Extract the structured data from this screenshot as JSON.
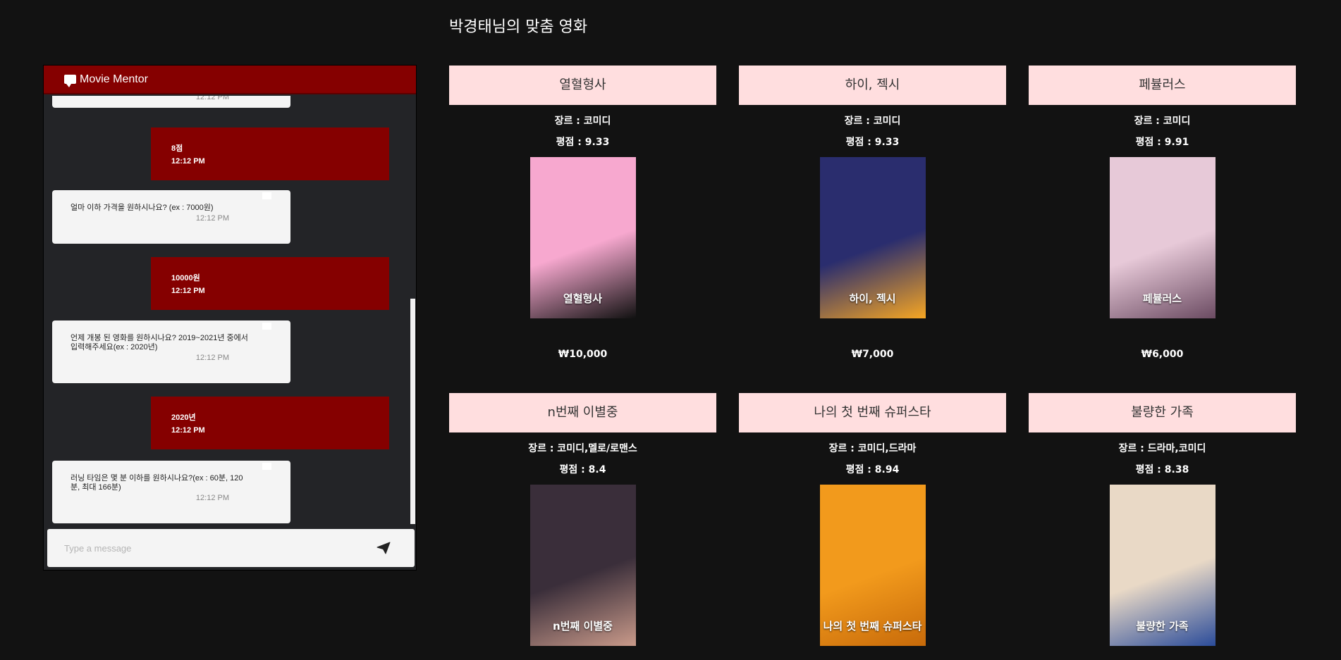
{
  "page": {
    "title": "박경태님의 맞춤 영화"
  },
  "chat": {
    "title": "Movie Mentor",
    "input_placeholder": "Type a message",
    "partial_top_time": "12:12 PM",
    "messages": [
      {
        "from": "user",
        "text": "8점",
        "time": "12:12 PM"
      },
      {
        "from": "bot",
        "text": "얼마 이하 가격을 원하시나요? (ex : 7000원)",
        "time": "12:12 PM"
      },
      {
        "from": "user",
        "text": "10000원",
        "time": "12:12 PM"
      },
      {
        "from": "bot",
        "text": "언제 개봉 된 영화를 원하시나요? 2019~2021년 중에서 입력해주세요(ex : 2020년)",
        "time": "12:12 PM"
      },
      {
        "from": "user",
        "text": "2020년",
        "time": "12:12 PM"
      },
      {
        "from": "bot",
        "text": "러닝 타임은 몇 분 이하를 원하시나요?(ex : 60분, 120분, 최대 166분)",
        "time": "12:12 PM"
      }
    ]
  },
  "movies": [
    {
      "title": "열혈형사",
      "genre": "장르 : 코미디",
      "rating": "평점 : 9.33",
      "price": "₩10,000",
      "poster_text": "열혈형사",
      "poster_colors": [
        "#f7a8cf",
        "#111111"
      ]
    },
    {
      "title": "하이, 젝시",
      "genre": "장르 : 코미디",
      "rating": "평점 : 9.33",
      "price": "₩7,000",
      "poster_text": "하이, 젝시",
      "poster_colors": [
        "#2a2d6e",
        "#f6a623"
      ]
    },
    {
      "title": "페뷸러스",
      "genre": "장르 : 코미디",
      "rating": "평점 : 9.91",
      "price": "₩6,000",
      "poster_text": "페뷸러스",
      "poster_colors": [
        "#e7c9d8",
        "#6b4b62"
      ]
    },
    {
      "title": "n번째 이별중",
      "genre": "장르 : 코미디,멜로/로맨스",
      "rating": "평점 : 8.4",
      "price": "",
      "poster_text": "n번째 이별중",
      "poster_colors": [
        "#3a2e3a",
        "#c99a8a"
      ]
    },
    {
      "title": "나의 첫 번째 슈퍼스타",
      "genre": "장르 : 코미디,드라마",
      "rating": "평점 : 8.94",
      "price": "",
      "poster_text": "나의 첫 번째 슈퍼스타",
      "poster_colors": [
        "#f29a1c",
        "#c76a0a"
      ]
    },
    {
      "title": "불량한 가족",
      "genre": "장르 : 드라마,코미디",
      "rating": "평점 : 8.38",
      "price": "",
      "poster_text": "불량한 가족",
      "poster_colors": [
        "#e9d9c6",
        "#2b4c9a"
      ]
    }
  ]
}
